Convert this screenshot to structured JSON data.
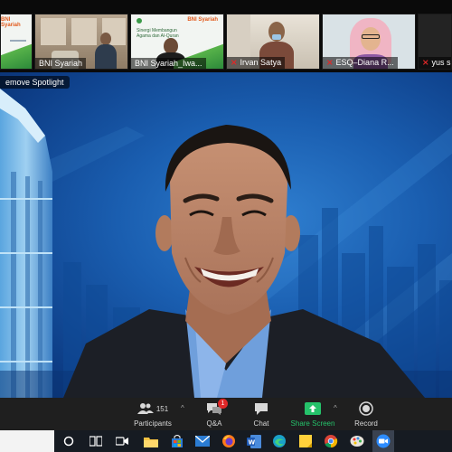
{
  "main_view": {
    "spotlight_label": "emove Spotlight"
  },
  "thumbnails": [
    {
      "name": ""
    },
    {
      "name": "BNI Syariah"
    },
    {
      "name": "BNI Syariah_Iwa..."
    },
    {
      "name": "Irvan Satya",
      "muted": true
    },
    {
      "name": "ESQ–Diana R...",
      "muted": true
    },
    {
      "name": "yus su",
      "muted": true
    }
  ],
  "slide_text": {
    "logo": "BNI Syariah",
    "title_line": "Sinergi Membangun Agama dan Al-Quran"
  },
  "controls": {
    "participants": {
      "label": "Participants",
      "count": "151"
    },
    "qa": {
      "label": "Q&A",
      "badge": "1"
    },
    "chat": {
      "label": "Chat"
    },
    "share": {
      "label": "Share Screen"
    },
    "record": {
      "label": "Record"
    }
  },
  "colors": {
    "share_green": "#25c26a",
    "muted_red": "#e02828",
    "background_blue": "#1a5eb0"
  },
  "taskbar": {
    "icons": [
      "cortana-icon",
      "task-view-icon",
      "meet-icon",
      "file-explorer-icon",
      "store-icon",
      "mail-icon",
      "firefox-icon",
      "word-icon",
      "edge-icon",
      "sticky-notes-icon",
      "chrome-icon",
      "paint-icon",
      "zoom-icon"
    ]
  }
}
